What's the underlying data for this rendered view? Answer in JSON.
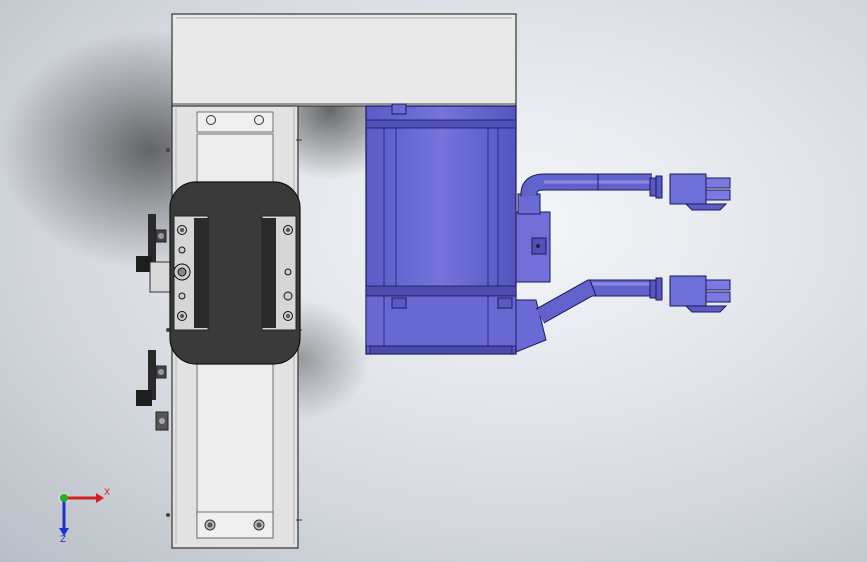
{
  "viewport": {
    "background_colors": [
      "#f4f6f9",
      "#d9dde3",
      "#b9bec6"
    ]
  },
  "model": {
    "actuator_body_color": "#e6e6e6",
    "carriage_color": "#3a3a3a",
    "motor_color": "#6f6fd6",
    "motor_dark_color": "#4b4bb0",
    "cable_color": "#6262cc"
  },
  "triad": {
    "x_label": "X",
    "z_label": "Z",
    "x_color": "#d42020",
    "y_color": "#20b020",
    "z_color": "#2030d0"
  }
}
